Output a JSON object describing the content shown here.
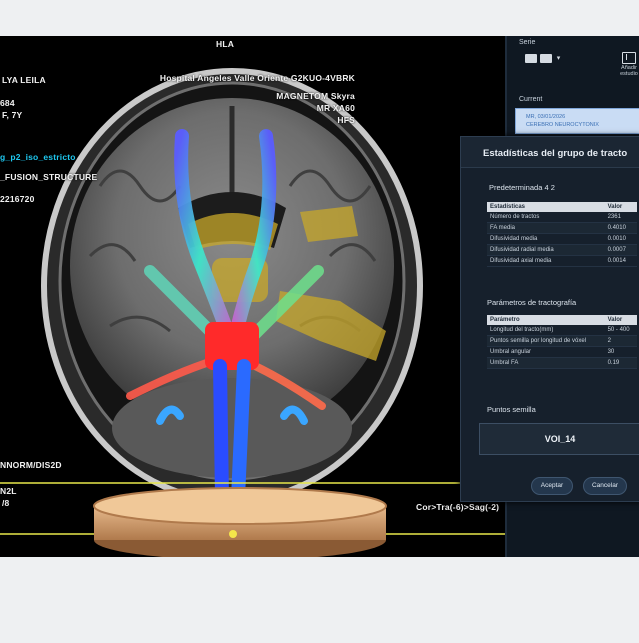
{
  "viewer": {
    "view_label": "HLA",
    "patient_name": "LYA LEILA",
    "patient_id": "684",
    "sex_age": "F, 7Y",
    "sequence": "g_p2_iso_estricto",
    "fusion": "_FUSION_STRUCTURE",
    "number": "2216720",
    "hospital": "Hospital Angeles Valle Oriente G2KUO-4VBRK",
    "scanner": "MAGNETOM Skyra",
    "model": "MR XA60",
    "position": "HFS",
    "norm": "NNORM/DIS2D",
    "code_n2l": "N2L",
    "code_slash": "/8",
    "orientation": "Cor>Tra(-6)>Sag(-2)"
  },
  "sidebar": {
    "serie_label": "Serie",
    "add_label": "Añadir estudio",
    "current_label": "Current",
    "current_item_line1": "MR, 03/01/2026",
    "current_item_line2": "CEREBRO NEUROCYTONIX"
  },
  "dialog": {
    "title": "Estadísticas del grupo de tracto",
    "subtitle": "Predeterminada  4  2",
    "stats_headers": [
      "Estadísticas",
      "Valor"
    ],
    "stats": [
      {
        "name": "Número de tractos",
        "value": "2361"
      },
      {
        "name": "FA media",
        "value": "0.4010"
      },
      {
        "name": "Difusividad media",
        "value": "0.0010"
      },
      {
        "name": "Difusividad radial media",
        "value": "0.0007"
      },
      {
        "name": "Difusividad axial media",
        "value": "0.0014"
      }
    ],
    "params_title": "Parámetros de tractografía",
    "params_headers": [
      "Parámetro",
      "Valor"
    ],
    "params": [
      {
        "name": "Longitud del tracto(mm)",
        "value": "50 - 400"
      },
      {
        "name": "Puntos semilla por longitud de vóxel",
        "value": "2"
      },
      {
        "name": "Umbral angular",
        "value": "30"
      },
      {
        "name": "Umbral FA",
        "value": "0.19"
      }
    ],
    "seeds_title": "Puntos semilla",
    "voi": "VOI_14",
    "accept": "Aceptar",
    "cancel": "Cancelar"
  },
  "colors": {
    "background": "#050607",
    "overlay_text": "#f2f2f2",
    "sequence_text": "#1ec8f0",
    "dialog_bg": "#16202c",
    "current_highlight": "#c9dcf4",
    "volume_overlay": "#c8a82a"
  }
}
